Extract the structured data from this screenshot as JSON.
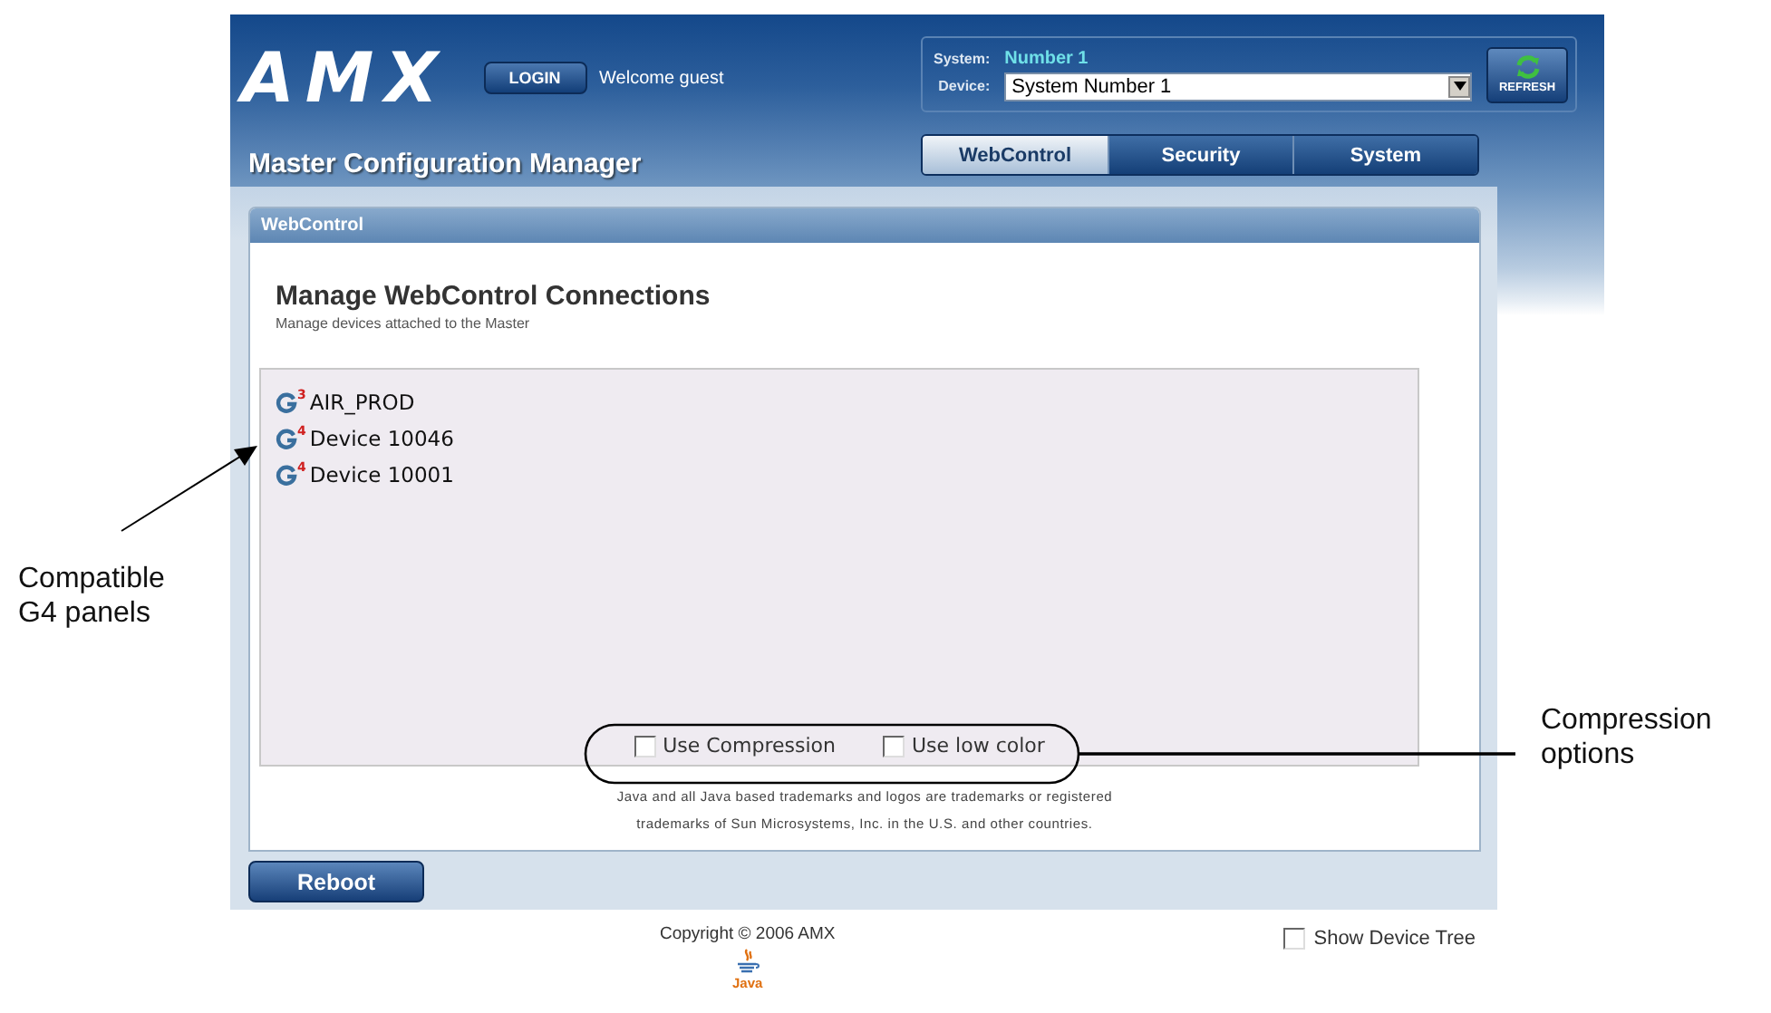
{
  "header": {
    "logo": "AMX",
    "login_button": "LOGIN",
    "welcome": "Welcome guest",
    "system_label": "System:",
    "system_value": "Number 1",
    "device_label": "Device:",
    "device_value": "System Number 1",
    "refresh_button": "REFRESH",
    "app_title": "Master Configuration Manager"
  },
  "tabs": [
    {
      "label": "WebControl",
      "selected": true
    },
    {
      "label": "Security",
      "selected": false
    },
    {
      "label": "System",
      "selected": false
    }
  ],
  "panel": {
    "header": "WebControl",
    "title": "Manage WebControl Connections",
    "subtitle": "Manage devices attached to the Master",
    "devices": [
      {
        "name": "AIR_PROD",
        "badge": "3"
      },
      {
        "name": "Device 10046",
        "badge": "4"
      },
      {
        "name": "Device 10001",
        "badge": "4"
      }
    ],
    "options": [
      {
        "label": "Use Compression",
        "checked": false
      },
      {
        "label": "Use low color",
        "checked": false
      }
    ],
    "legal": [
      "Java and all Java based trademarks and logos are trademarks or registered",
      "trademarks of Sun Microsystems, Inc. in the U.S. and other countries."
    ]
  },
  "reboot_button": "Reboot",
  "footer": {
    "copyright": "Copyright © 2006 AMX",
    "java_logo": "Java",
    "show_device_tree": {
      "label": "Show Device Tree",
      "checked": false
    }
  },
  "callouts": [
    {
      "kind": "arrow",
      "text": "Compatible G4 panels"
    },
    {
      "kind": "ellipse",
      "text": "Compression options"
    }
  ]
}
